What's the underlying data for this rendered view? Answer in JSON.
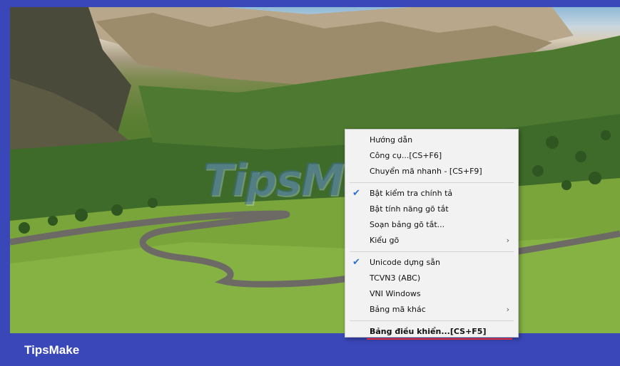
{
  "watermark": {
    "text": "TipsMake"
  },
  "context_menu": {
    "groups": [
      [
        {
          "label": "Hướng dẫn",
          "checked": false,
          "submenu": false
        },
        {
          "label": "Công cụ...[CS+F6]",
          "checked": false,
          "submenu": false
        },
        {
          "label": "Chuyển mã nhanh - [CS+F9]",
          "checked": false,
          "submenu": false
        }
      ],
      [
        {
          "label": "Bật kiểm tra chính tả",
          "checked": true,
          "submenu": false
        },
        {
          "label": "Bật tính năng gõ tắt",
          "checked": false,
          "submenu": false
        },
        {
          "label": "Soạn bảng gõ tắt...",
          "checked": false,
          "submenu": false
        },
        {
          "label": "Kiểu gõ",
          "checked": false,
          "submenu": true
        }
      ],
      [
        {
          "label": "Unicode dựng sẵn",
          "checked": true,
          "submenu": false
        },
        {
          "label": "TCVN3 (ABC)",
          "checked": false,
          "submenu": false
        },
        {
          "label": "VNI Windows",
          "checked": false,
          "submenu": false
        },
        {
          "label": "Bảng mã khác",
          "checked": false,
          "submenu": true
        }
      ],
      [
        {
          "label": "Bảng điều khiển...[CS+F5]",
          "checked": false,
          "submenu": false,
          "bold": true,
          "highlighted": true
        }
      ]
    ],
    "check_glyph": "✔",
    "submenu_glyph": "›",
    "accent_color": "#2a6fd6",
    "highlight_color": "#e0303a"
  },
  "footer": {
    "brand": "TipsMake"
  }
}
